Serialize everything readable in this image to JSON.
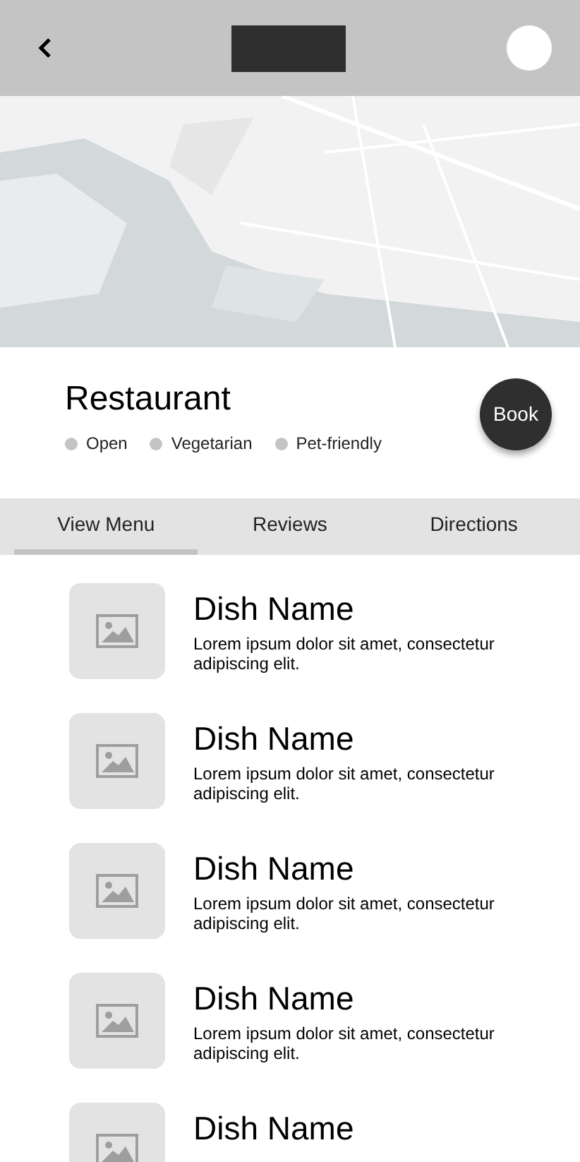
{
  "restaurant": {
    "name": "Restaurant",
    "tags": [
      "Open",
      "Vegetarian",
      "Pet-friendly"
    ],
    "book_button": "Book"
  },
  "tabs": [
    {
      "label": "View Menu",
      "selected": true
    },
    {
      "label": "Reviews",
      "selected": false
    },
    {
      "label": "Directions",
      "selected": false
    }
  ],
  "dishes": [
    {
      "name": "Dish Name",
      "description": "Lorem ipsum dolor sit amet, consectetur adipiscing elit."
    },
    {
      "name": "Dish Name",
      "description": "Lorem ipsum dolor sit amet, consectetur adipiscing elit."
    },
    {
      "name": "Dish Name",
      "description": "Lorem ipsum dolor sit amet, consectetur adipiscing elit."
    },
    {
      "name": "Dish Name",
      "description": "Lorem ipsum dolor sit amet, consectetur adipiscing elit."
    },
    {
      "name": "Dish Name"
    }
  ]
}
